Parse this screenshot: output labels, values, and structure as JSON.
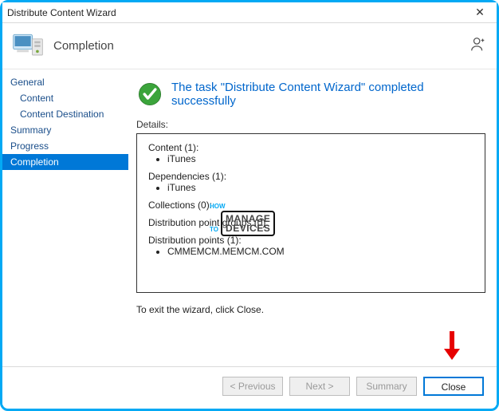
{
  "window": {
    "title": "Distribute Content Wizard",
    "close_glyph": "✕"
  },
  "header": {
    "title": "Completion"
  },
  "sidebar": {
    "items": [
      {
        "label": "General",
        "indent": false,
        "selected": false
      },
      {
        "label": "Content",
        "indent": true,
        "selected": false
      },
      {
        "label": "Content Destination",
        "indent": true,
        "selected": false
      },
      {
        "label": "Summary",
        "indent": false,
        "selected": false
      },
      {
        "label": "Progress",
        "indent": false,
        "selected": false
      },
      {
        "label": "Completion",
        "indent": false,
        "selected": true
      }
    ]
  },
  "main": {
    "status_text": "The task \"Distribute Content Wizard\" completed successfully",
    "details_label": "Details:",
    "details": {
      "content_head": "Content (1):",
      "content_items": [
        "iTunes"
      ],
      "dependencies_head": "Dependencies (1):",
      "dependencies_items": [
        "iTunes"
      ],
      "collections_head": "Collections (0):",
      "dpg_head": "Distribution point groups (0):",
      "dp_head": "Distribution points (1):",
      "dp_items": [
        "CMMEMCM.MEMCM.COM"
      ]
    },
    "exit_text": "To exit the wizard, click Close."
  },
  "footer": {
    "previous": "< Previous",
    "next": "Next >",
    "summary": "Summary",
    "close": "Close"
  },
  "watermark": {
    "how": "HOW",
    "to": "TO",
    "manage": "MANAGE",
    "devices": "DEVICES"
  }
}
